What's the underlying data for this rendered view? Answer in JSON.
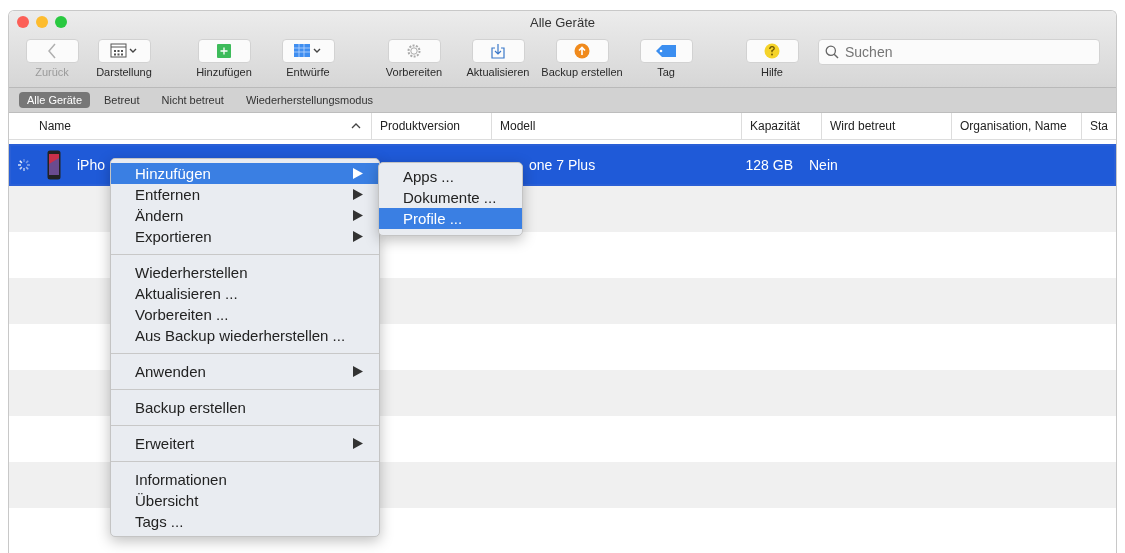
{
  "window": {
    "title": "Alle Geräte"
  },
  "toolbar": {
    "groups": [
      [
        {
          "label": "Zurück",
          "kind": "back",
          "disabled": true
        },
        {
          "label": "Darstellung",
          "kind": "view",
          "disabled": false
        }
      ],
      [
        {
          "label": "Hinzufügen",
          "kind": "add",
          "disabled": false
        },
        {
          "label": "Entwürfe",
          "kind": "blueprints",
          "disabled": false
        }
      ],
      [
        {
          "label": "Vorbereiten",
          "kind": "prepare",
          "disabled": false
        },
        {
          "label": "Aktualisieren",
          "kind": "update",
          "disabled": false
        },
        {
          "label": "Backup erstellen",
          "kind": "backup",
          "disabled": false
        },
        {
          "label": "Tag",
          "kind": "tag",
          "disabled": false
        }
      ],
      [
        {
          "label": "Hilfe",
          "kind": "help",
          "disabled": false
        }
      ]
    ],
    "search": {
      "placeholder": "Suchen"
    }
  },
  "filters": [
    {
      "label": "Alle Geräte",
      "selected": true
    },
    {
      "label": "Betreut",
      "selected": false
    },
    {
      "label": "Nicht betreut",
      "selected": false
    },
    {
      "label": "Wiederherstellungsmodus",
      "selected": false
    }
  ],
  "table": {
    "columns": [
      "Name",
      "Produktversion",
      "Modell",
      "Kapazität",
      "Wird betreut",
      "Organisation, Name",
      "Sta"
    ],
    "rows": [
      {
        "name": "iPho",
        "model": "one 7 Plus",
        "capacity": "128 GB",
        "supervised": "Nein",
        "selected": true,
        "busy": true
      }
    ]
  },
  "context_menu": {
    "groups": [
      [
        {
          "label": "Hinzufügen",
          "submenu": true,
          "selected": true
        },
        {
          "label": "Entfernen",
          "submenu": true,
          "selected": false
        },
        {
          "label": "Ändern",
          "submenu": true,
          "selected": false
        },
        {
          "label": "Exportieren",
          "submenu": true,
          "selected": false
        }
      ],
      [
        {
          "label": "Wiederherstellen",
          "submenu": false,
          "selected": false
        },
        {
          "label": "Aktualisieren ...",
          "submenu": false,
          "selected": false
        },
        {
          "label": "Vorbereiten ...",
          "submenu": false,
          "selected": false
        },
        {
          "label": "Aus Backup wiederherstellen ...",
          "submenu": false,
          "selected": false
        }
      ],
      [
        {
          "label": "Anwenden",
          "submenu": true,
          "selected": false
        }
      ],
      [
        {
          "label": "Backup erstellen",
          "submenu": false,
          "selected": false
        }
      ],
      [
        {
          "label": "Erweitert",
          "submenu": true,
          "selected": false
        }
      ],
      [
        {
          "label": "Informationen",
          "submenu": false,
          "selected": false
        },
        {
          "label": "Übersicht",
          "submenu": false,
          "selected": false
        },
        {
          "label": "Tags ...",
          "submenu": false,
          "selected": false
        }
      ]
    ]
  },
  "submenu": {
    "items": [
      {
        "label": "Apps ...",
        "selected": false
      },
      {
        "label": "Dokumente ...",
        "selected": false
      },
      {
        "label": "Profile ...",
        "selected": true
      }
    ]
  }
}
